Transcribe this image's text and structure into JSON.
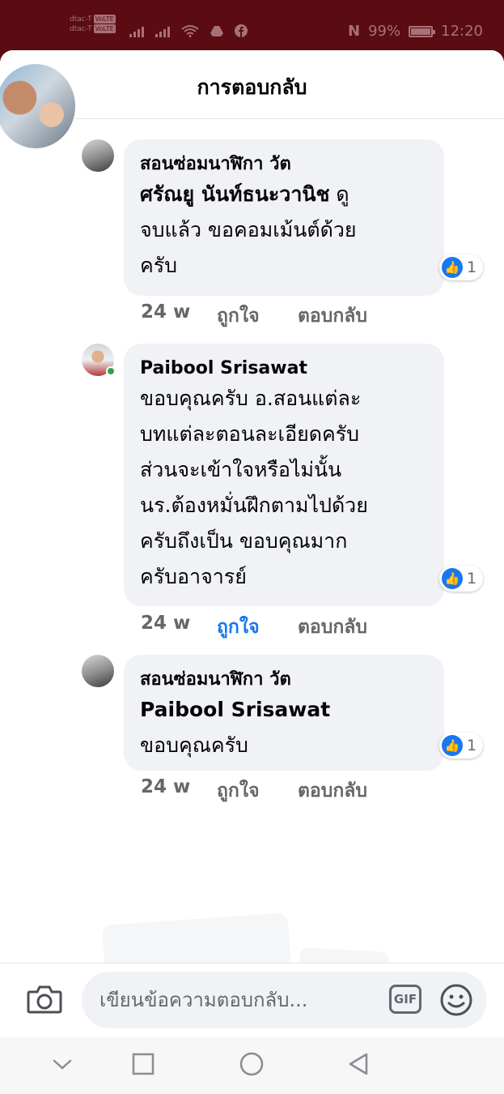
{
  "status_bar": {
    "carrier1": "dtac-T",
    "carrier2": "dtac-T",
    "volte1": "VoLTE",
    "volte2": "VoLTE",
    "battery_text": "99%",
    "battery_level": 0.99,
    "time": "12:20",
    "nfc_label": "N"
  },
  "header": {
    "title": "การตอบกลับ"
  },
  "comments": [
    {
      "author": "สอนซ่อมนาฬิกา วัต",
      "tag": "ศรัณยู นันท์ธนะวานิช",
      "lines": [
        "ดู",
        "จบแล้ว ขอคอมเม้นต์ด้วย",
        "ครับ"
      ],
      "reaction_count": "1",
      "time": "24 w",
      "like_label": "ถูกใจ",
      "liked": false,
      "reply_label": "ตอบกลับ"
    },
    {
      "author": "Paibool Srisawat",
      "lines": [
        "ขอบคุณครับ อ.สอนแต่ละ",
        "บทแต่ละตอนละเอียดครับ",
        "ส่วนจะเข้าใจหรือไม่นั้น",
        "นร.ต้องหมั่นฝึกตามไปด้วย",
        "ครับถึงเป็น ขอบคุณมาก",
        "ครับอาจารย์"
      ],
      "reaction_count": "1",
      "time": "24 w",
      "like_label": "ถูกใจ",
      "liked": true,
      "reply_label": "ตอบกลับ"
    },
    {
      "author": "สอนซ่อมนาฬิกา วัต",
      "tag": "Paibool Srisawat",
      "lines": [
        "ขอบคุณครับ"
      ],
      "reaction_count": "1",
      "time": "24 w",
      "like_label": "ถูกใจ",
      "liked": false,
      "reply_label": "ตอบกลับ"
    }
  ],
  "composer": {
    "placeholder": "เขียนข้อความตอบกลับ...",
    "gif_label": "GIF",
    "camera_icon": "camera-icon",
    "emoji_icon": "smiley-icon"
  },
  "colors": {
    "accent": "#1877f2",
    "status_bar_bg": "#5a0c12",
    "bubble_bg": "#f0f2f5",
    "muted_text": "#65676b",
    "online": "#31a24c"
  }
}
